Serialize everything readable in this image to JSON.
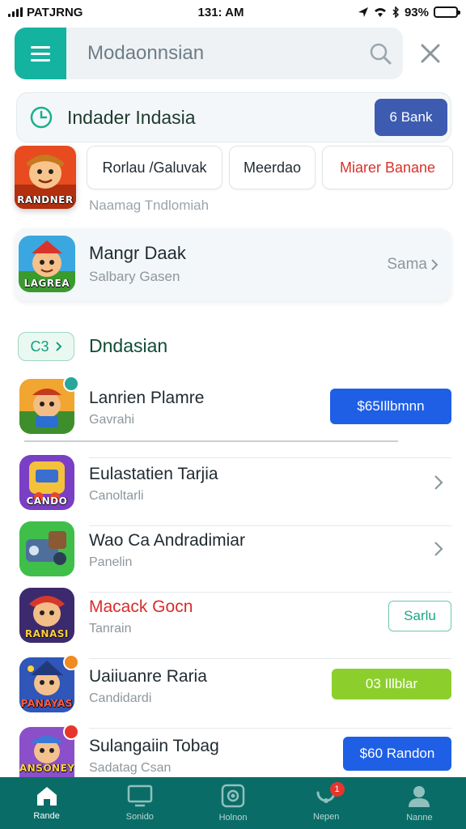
{
  "status_bar": {
    "carrier": "PATJRNG",
    "time": "131: AM",
    "battery": "93%",
    "battery_level": 0.93
  },
  "search": {
    "value": "Modaonnsian"
  },
  "featured": {
    "title": "Indader Indasia",
    "button_label": "6 Bank",
    "thumb_label": "RANDNER",
    "chips": [
      "Rorlau /Galuvak",
      "Meerdao",
      "Miarer Banane"
    ],
    "subtitle": "Naamag Tndlomiah"
  },
  "card": {
    "title": "Mangr Daak",
    "subtitle": "Salbary Gasen",
    "action_label": "Sama",
    "thumb_label": "LAGREA"
  },
  "section": {
    "badge_label": "C3",
    "title": "Dndasian"
  },
  "list": [
    {
      "title": "Lanrien Plamre",
      "subtitle": "Gavrahi",
      "button": "$65Illbmnn",
      "button_style": "blue",
      "title_color": "#1f2a30",
      "badge_color": "#27a69a",
      "thumb_label": ""
    },
    {
      "title": "Eulastatien Tarjia",
      "subtitle": "Canoltarli",
      "button": "",
      "button_style": "chevron",
      "title_color": "#1f2a30",
      "badge_color": "",
      "thumb_label": "CANDO"
    },
    {
      "title": "Wao Ca Andradimiar",
      "subtitle": "Panelin",
      "button": "",
      "button_style": "chevron",
      "title_color": "#1f2a30",
      "badge_color": "",
      "thumb_label": ""
    },
    {
      "title": "Macack Gocn",
      "subtitle": "Tanrain",
      "button": "Sarlu",
      "button_style": "outline",
      "title_color": "#d92c2c",
      "badge_color": "",
      "thumb_label": "RANASI"
    },
    {
      "title": "Uaiiuanre Raria",
      "subtitle": "Candidardi",
      "button": "03 Illblar",
      "button_style": "green",
      "title_color": "#1f2a30",
      "badge_color": "#f08a21",
      "thumb_label": "PANAYAS"
    },
    {
      "title": "Sulangaiin Tobag",
      "subtitle": "Sadatag Csan",
      "button": "$60 Randon",
      "button_style": "blue",
      "title_color": "#1f2a30",
      "badge_color": "#e6352c",
      "thumb_label": "ANSONEY"
    }
  ],
  "nav": [
    {
      "label": "Rande",
      "icon": "home-icon"
    },
    {
      "label": "Sonido",
      "icon": "monitor-icon"
    },
    {
      "label": "Holnon",
      "icon": "camera-icon"
    },
    {
      "label": "Nepen",
      "icon": "notification-icon",
      "badge": "1"
    },
    {
      "label": "Nanne",
      "icon": "profile-icon"
    }
  ],
  "colors": {
    "accent": "#13b3a0",
    "nav_bg": "#0a6c67",
    "primary_button": "#1f5fe6",
    "featured_button": "#3d5bb0"
  }
}
